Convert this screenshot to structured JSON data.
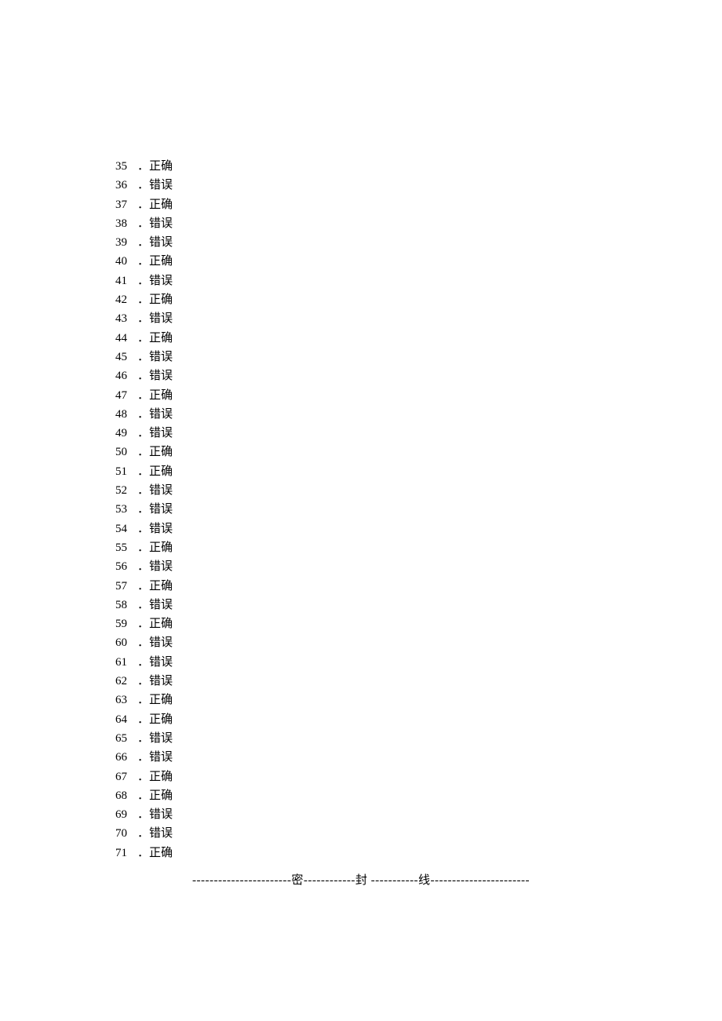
{
  "items": [
    {
      "num": "35",
      "sep": "．",
      "text": "正确"
    },
    {
      "num": "36",
      "sep": "．",
      "text": "错误"
    },
    {
      "num": "37",
      "sep": "．",
      "text": "正确"
    },
    {
      "num": "38",
      "sep": "．",
      "text": "错误"
    },
    {
      "num": "39",
      "sep": "．",
      "text": "错误"
    },
    {
      "num": "40",
      "sep": "．",
      "text": "正确"
    },
    {
      "num": "41",
      "sep": "．",
      "text": "错误"
    },
    {
      "num": "42",
      "sep": "．",
      "text": "正确"
    },
    {
      "num": "43",
      "sep": "．",
      "text": "错误"
    },
    {
      "num": "44",
      "sep": "．",
      "text": "正确"
    },
    {
      "num": "45",
      "sep": "．",
      "text": "错误"
    },
    {
      "num": "46",
      "sep": "．",
      "text": "错误"
    },
    {
      "num": "47",
      "sep": "．",
      "text": "正确"
    },
    {
      "num": "48",
      "sep": "．",
      "text": "错误"
    },
    {
      "num": "49",
      "sep": "．",
      "text": "错误"
    },
    {
      "num": "50",
      "sep": "．",
      "text": "正确"
    },
    {
      "num": "51",
      "sep": "．",
      "text": "正确"
    },
    {
      "num": "52",
      "sep": "．",
      "text": "错误"
    },
    {
      "num": "53",
      "sep": "．",
      "text": "错误"
    },
    {
      "num": "54",
      "sep": "．",
      "text": "错误"
    },
    {
      "num": "55",
      "sep": "．",
      "text": "正确"
    },
    {
      "num": "56",
      "sep": "．",
      "text": "错误"
    },
    {
      "num": "57",
      "sep": "．",
      "text": "正确"
    },
    {
      "num": "58",
      "sep": "．",
      "text": "错误"
    },
    {
      "num": "59",
      "sep": "．",
      "text": "正确"
    },
    {
      "num": "60",
      "sep": "．",
      "text": "错误"
    },
    {
      "num": "61",
      "sep": "．",
      "text": "错误"
    },
    {
      "num": "62",
      "sep": "．",
      "text": "错误"
    },
    {
      "num": "63",
      "sep": "．",
      "text": "正确"
    },
    {
      "num": "64",
      "sep": "．",
      "text": "正确"
    },
    {
      "num": "65",
      "sep": "．",
      "text": "错误"
    },
    {
      "num": "66",
      "sep": "．",
      "text": "错误"
    },
    {
      "num": "67",
      "sep": "．",
      "text": "正确"
    },
    {
      "num": "68",
      "sep": "．",
      "text": "正确"
    },
    {
      "num": "69",
      "sep": "．",
      "text": "错误"
    },
    {
      "num": "70",
      "sep": "．",
      "text": "错误"
    },
    {
      "num": "71",
      "sep": "．",
      "text": "正确"
    }
  ],
  "footer": "-----------------------密------------封 -----------线-----------------------"
}
